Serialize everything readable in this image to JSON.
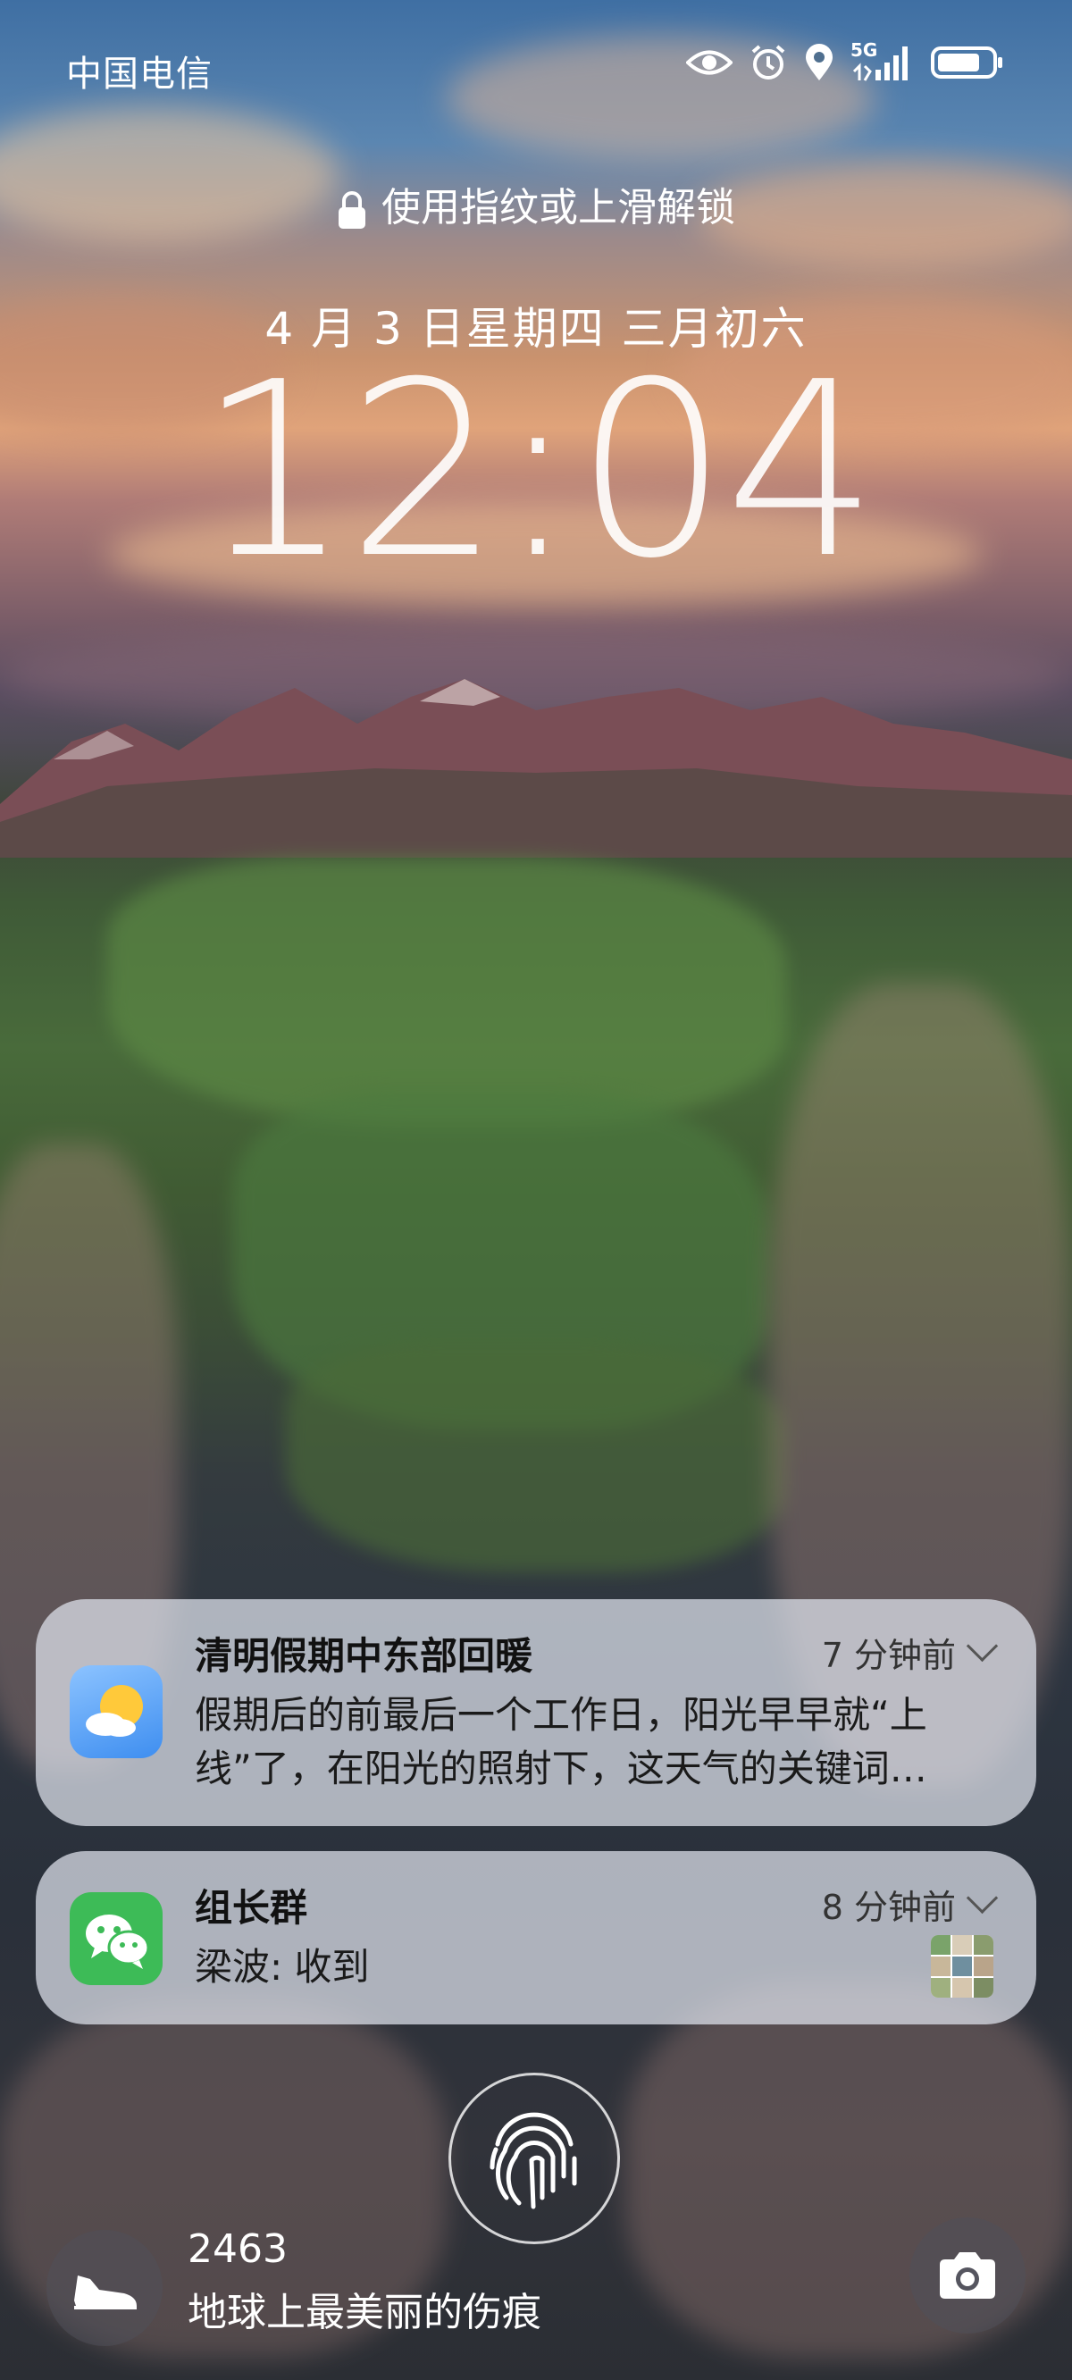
{
  "status_bar": {
    "carrier": "中国电信",
    "network": "5G",
    "icons": [
      "eye-icon",
      "alarm-icon",
      "location-icon",
      "signal-icon",
      "battery-icon"
    ]
  },
  "lock_screen": {
    "unlock_hint": "使用指纹或上滑解锁",
    "date": "4 月 3 日星期四 三月初六",
    "time": "12:04"
  },
  "notifications": [
    {
      "app_icon": "weather-sun-icon",
      "title": "清明假期中东部回暖",
      "time": "7 分钟前",
      "body": "假期后的前最后一个工作日，阳光早早就“上线”了，在阳光的照射下，这天气的关键词…"
    },
    {
      "app_icon": "wechat-icon",
      "title": "组长群",
      "time": "8 分钟前",
      "body": "梁波: 收到"
    }
  ],
  "bottom": {
    "steps": "2463",
    "wallpaper_caption": "地球上最美丽的伤痕",
    "left_icon": "shoe-icon",
    "right_icon": "camera-icon"
  },
  "colors": {
    "notification_bg": "#e1e4ee",
    "wechat_green": "#3dbb57",
    "weather_blue": "#4f9bf0"
  }
}
